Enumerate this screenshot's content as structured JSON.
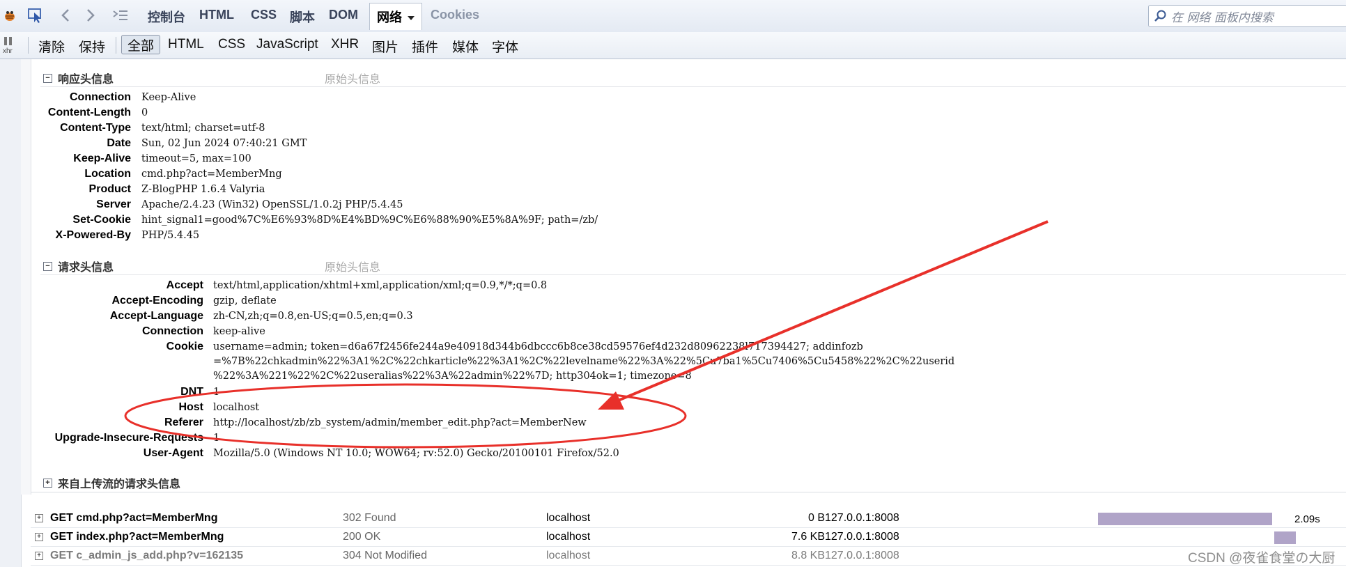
{
  "toolbar": {
    "tabs": [
      "控制台",
      "HTML",
      "CSS",
      "脚本",
      "DOM",
      "网络",
      "Cookies"
    ],
    "search_placeholder": "在 网络 面板内搜索"
  },
  "filters": {
    "clear": "清除",
    "persist": "保持",
    "types": [
      "全部",
      "HTML",
      "CSS",
      "JavaScript",
      "XHR",
      "图片",
      "插件",
      "媒体",
      "字体"
    ],
    "xhr_small": "xhr"
  },
  "response": {
    "title": "响应头信息",
    "raw": "原始头信息",
    "headers": [
      {
        "name": "Connection",
        "value": "Keep-Alive"
      },
      {
        "name": "Content-Length",
        "value": "0"
      },
      {
        "name": "Content-Type",
        "value": "text/html; charset=utf-8"
      },
      {
        "name": "Date",
        "value": "Sun, 02 Jun 2024 07:40:21 GMT"
      },
      {
        "name": "Keep-Alive",
        "value": "timeout=5, max=100"
      },
      {
        "name": "Location",
        "value": "cmd.php?act=MemberMng"
      },
      {
        "name": "Product",
        "value": "Z-BlogPHP 1.6.4 Valyria"
      },
      {
        "name": "Server",
        "value": "Apache/2.4.23 (Win32) OpenSSL/1.0.2j PHP/5.4.45"
      },
      {
        "name": "Set-Cookie",
        "value": "hint_signal1=good%7C%E6%93%8D%E4%BD%9C%E6%88%90%E5%8A%9F; path=/zb/"
      },
      {
        "name": "X-Powered-By",
        "value": "PHP/5.4.45"
      }
    ]
  },
  "request": {
    "title": "请求头信息",
    "raw": "原始头信息",
    "headers": [
      {
        "name": "Accept",
        "lines": [
          "text/html,application/xhtml+xml,application/xml;q=0.9,*/*;q=0.8"
        ]
      },
      {
        "name": "Accept-Encoding",
        "lines": [
          "gzip, deflate"
        ]
      },
      {
        "name": "Accept-Language",
        "lines": [
          "zh-CN,zh;q=0.8,en-US;q=0.5,en;q=0.3"
        ]
      },
      {
        "name": "Connection",
        "lines": [
          "keep-alive"
        ]
      },
      {
        "name": "Cookie",
        "lines": [
          "username=admin; token=d6a67f2456fe244a9e40918d344b6dbccc6b8ce38cd59576ef4d232d80962238l717394427; addinfozb",
          "=%7B%22chkadmin%22%3A1%2C%22chkarticle%22%3A1%2C%22levelname%22%3A%22%5Cu7ba1%5Cu7406%5Cu5458%22%2C%22userid",
          "%22%3A%221%22%2C%22useralias%22%3A%22admin%22%7D; http304ok=1; timezone=8"
        ]
      },
      {
        "name": "DNT",
        "lines": [
          "1"
        ]
      },
      {
        "name": "Host",
        "lines": [
          "localhost"
        ]
      },
      {
        "name": "Referer",
        "lines": [
          "http://localhost/zb/zb_system/admin/member_edit.php?act=MemberNew"
        ]
      },
      {
        "name": "Upgrade-Insecure-Requests",
        "lines": [
          "1"
        ]
      },
      {
        "name": "User-Agent",
        "lines": [
          "Mozilla/5.0 (Windows NT 10.0; WOW64; rv:52.0) Gecko/20100101 Firefox/52.0"
        ]
      }
    ]
  },
  "upstream": {
    "title": "来自上传流的请求头信息"
  },
  "requests": [
    {
      "url": "GET cmd.php?act=MemberMng",
      "status": "302 Found",
      "host": "localhost",
      "size": "0 B",
      "ip": "127.0.0.1:8008",
      "time": "2.09s",
      "bar_start": 0.0,
      "bar_len": 0.88,
      "dim": false
    },
    {
      "url": "GET index.php?act=MemberMng",
      "status": "200 OK",
      "host": "localhost",
      "size": "7.6 KB",
      "ip": "127.0.0.1:8008",
      "time": "",
      "bar_start": 0.89,
      "bar_len": 0.11,
      "dim": false
    },
    {
      "url": "GET c_admin_js_add.php?v=162135",
      "status": "304 Not Modified",
      "host": "localhost",
      "size": "8.8 KB",
      "ip": "127.0.0.1:8008",
      "time": "",
      "bar_start": 0.89,
      "bar_len": 0.11,
      "dim": true
    }
  ],
  "annotation": {
    "color": "#e8302a"
  },
  "watermark": "CSDN @夜雀食堂の大厨"
}
